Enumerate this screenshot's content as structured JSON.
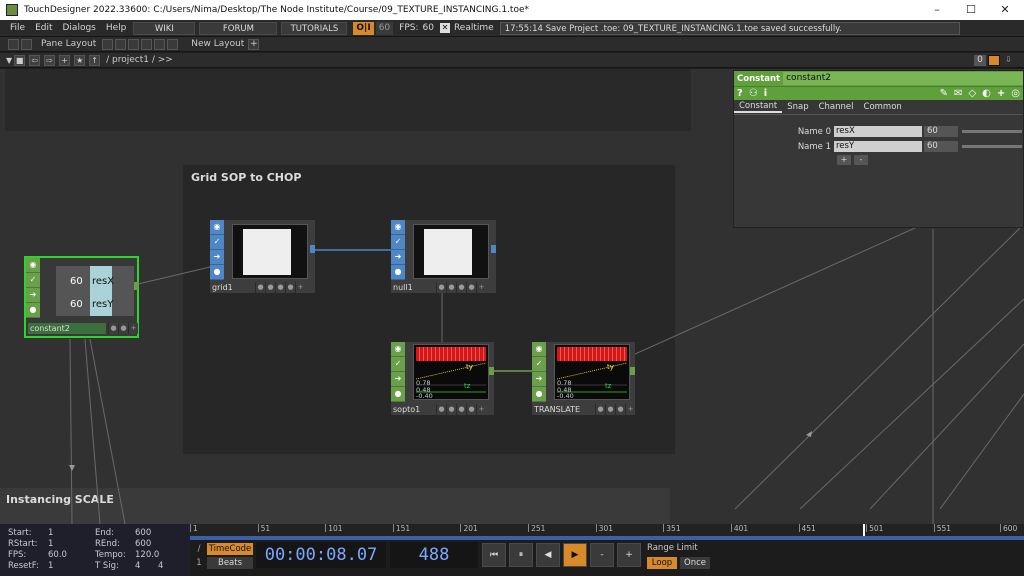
{
  "window": {
    "title": "TouchDesigner 2022.33600: C:/Users/Nima/Desktop/The Node Institute/Course/09_TEXTURE_INSTANCING.1.toe*",
    "minimize": "–",
    "maximize": "☐",
    "close": "✕"
  },
  "menu": {
    "items": [
      "File",
      "Edit",
      "Dialogs",
      "Help"
    ],
    "wiki": "WIKI",
    "forum": "FORUM",
    "tutorials": "TUTORIALS",
    "perf": "O|I",
    "cook": "60",
    "fps_label": "FPS:",
    "fps_value": "60",
    "realtime_check": "✕",
    "realtime": "Realtime",
    "status": "17:55:14 Save Project .toe: 09_TEXTURE_INSTANCING.1.toe saved successfully."
  },
  "panebar": {
    "pane_layout": "Pane Layout",
    "new_layout": "New Layout",
    "plus": "+"
  },
  "pathbar": {
    "path": "/ project1 / >>",
    "zero": "0"
  },
  "boxes": {
    "grid_title": "Grid SOP to CHOP",
    "instancing_title": "Instancing SCALE"
  },
  "nodes": {
    "constant2": {
      "label": "constant2",
      "v1": "60",
      "n1": "resX",
      "v2": "60",
      "n2": "resY"
    },
    "grid1": {
      "label": "grid1"
    },
    "null1": {
      "label": "null1"
    },
    "sopto1": {
      "label": "sopto1",
      "ty": "ty",
      "tz": "tz",
      "tx": "tx",
      "a": "0.78",
      "b": "0.48",
      "c": "-0.40"
    },
    "translate": {
      "label": "TRANSLATE",
      "ty": "ty",
      "tz": "tz",
      "tx": "tx",
      "a": "0.78",
      "b": "0.48",
      "c": "-0.40"
    }
  },
  "params": {
    "op_type": "Constant",
    "op_name": "constant2",
    "tabs": [
      "Constant",
      "Snap",
      "Channel",
      "Common"
    ],
    "rows": [
      {
        "label": "Name 0",
        "name": "resX",
        "value": "60"
      },
      {
        "label": "Name 1",
        "name": "resY",
        "value": "60"
      }
    ],
    "add": "+",
    "remove": "-"
  },
  "stats": {
    "start_l": "Start:",
    "start": "1",
    "end_l": "End:",
    "end": "600",
    "rstart_l": "RStart:",
    "rstart": "1",
    "rend_l": "REnd:",
    "rend": "600",
    "fps_l": "FPS:",
    "fps": "60.0",
    "tempo_l": "Tempo:",
    "tempo": "120.0",
    "resetf_l": "ResetF:",
    "resetf": "1",
    "tsig_l": "T Sig:",
    "tsig_a": "4",
    "tsig_b": "4"
  },
  "timeline": {
    "ticks": [
      "1",
      "51",
      "101",
      "151",
      "201",
      "251",
      "301",
      "351",
      "401",
      "451",
      "501",
      "551",
      "600"
    ],
    "timecode_btn": "TimeCode",
    "beats_btn": "Beats",
    "timecode": "00:00:08.07",
    "frame": "488",
    "range_limit": "Range Limit",
    "loop": "Loop",
    "once": "Once",
    "slash": "/",
    "one": "1"
  },
  "colors": {
    "sop": "#4f86c6",
    "chop": "#6ba04b",
    "selected": "#2bd62b",
    "accent": "#d88a2a"
  }
}
